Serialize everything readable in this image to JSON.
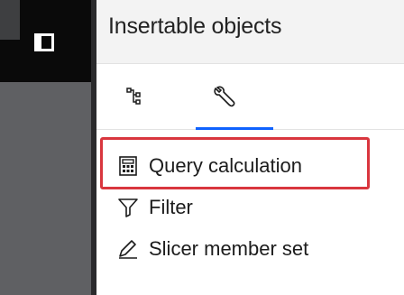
{
  "panel": {
    "title": "Insertable objects",
    "tabs": [
      {
        "icon": "data-tree-icon",
        "active": false
      },
      {
        "icon": "wrench-icon",
        "active": true
      }
    ]
  },
  "items": [
    {
      "label": "Query calculation",
      "icon": "calculator-icon"
    },
    {
      "label": "Filter",
      "icon": "filter-icon"
    },
    {
      "label": "Slicer member set",
      "icon": "slicer-pen-icon"
    }
  ],
  "colors": {
    "accent": "#0f62fe",
    "highlight": "#d9363e",
    "rail": "#5f6063",
    "rail_top": "#0a0a0a"
  }
}
